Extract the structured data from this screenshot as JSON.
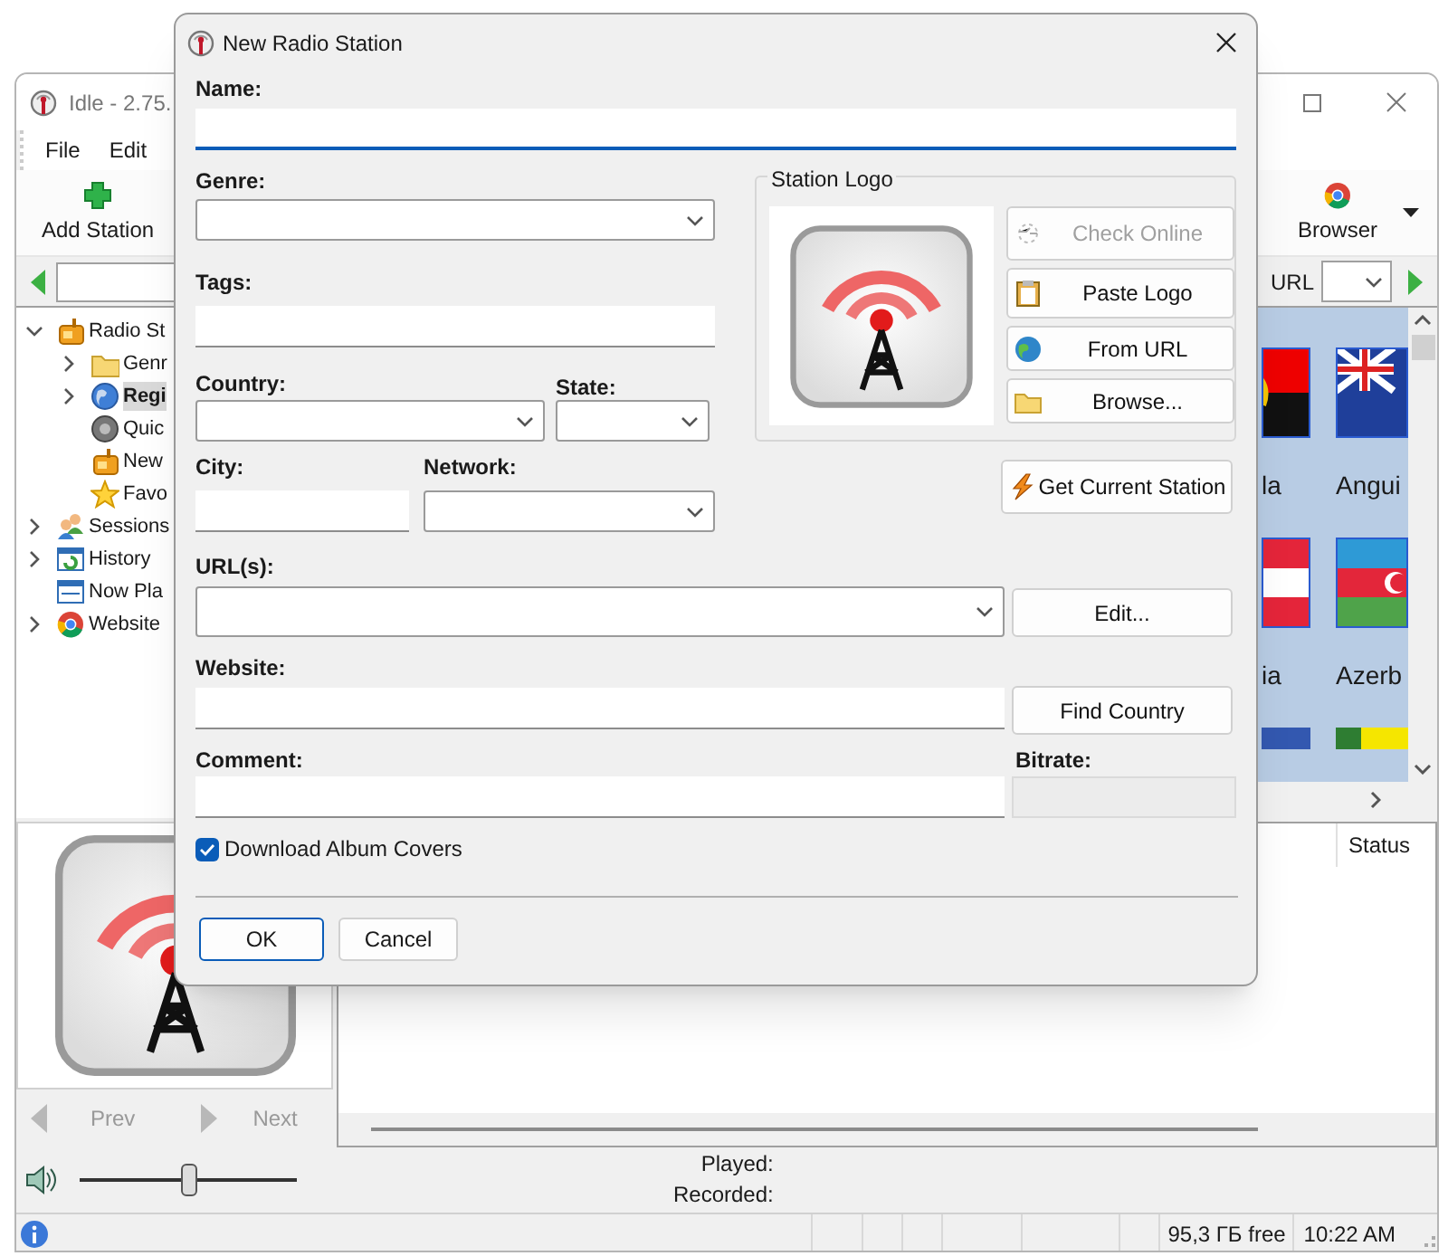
{
  "main_window": {
    "title": "Idle - 2.75.",
    "menu": [
      {
        "label": "File"
      },
      {
        "label": "Edit"
      }
    ],
    "toolbar": [
      {
        "label": "Add Station",
        "kind": "add"
      },
      {
        "label": "Browser",
        "kind": "browser"
      }
    ],
    "address_bar": {
      "url_label": "URL"
    },
    "tree": [
      {
        "label": "Radio St",
        "kind": "radio",
        "expandable": true,
        "expanded": true,
        "selected": false,
        "children": [
          {
            "label": "Genr",
            "kind": "folder",
            "expandable": true,
            "expanded": false,
            "selected": false
          },
          {
            "label": "Regi",
            "kind": "globe",
            "expandable": true,
            "expanded": false,
            "selected": true
          },
          {
            "label": "Quic",
            "kind": "podcast",
            "expandable": false,
            "expanded": false,
            "selected": false
          },
          {
            "label": "New",
            "kind": "radio",
            "expandable": false,
            "expanded": false,
            "selected": false
          },
          {
            "label": "Favo",
            "kind": "star",
            "expandable": false,
            "expanded": false,
            "selected": false
          }
        ]
      },
      {
        "label": "Sessions",
        "kind": "people",
        "expandable": true,
        "expanded": false,
        "selected": false
      },
      {
        "label": "History",
        "kind": "history",
        "expandable": true,
        "expanded": false,
        "selected": false
      },
      {
        "label": "Now Pla",
        "kind": "window",
        "expandable": false,
        "expanded": false,
        "selected": false
      },
      {
        "label": "Website",
        "kind": "chrome",
        "expandable": true,
        "expanded": false,
        "selected": false
      }
    ],
    "flags": [
      {
        "label": "la"
      },
      {
        "label": "Angui"
      },
      {
        "label": "ia"
      },
      {
        "label": "Azerb"
      }
    ],
    "list": {
      "columns": [
        {
          "label": "Status"
        }
      ]
    },
    "player": {
      "prev": {
        "label": "Prev",
        "disabled": true
      },
      "next": {
        "label": "Next",
        "disabled": true
      },
      "volume": {
        "level": 0.5
      },
      "played_label": "Played:",
      "recorded_label": "Recorded:"
    },
    "status_bar": {
      "free_space": "95,3 ГБ free",
      "time": "10:22 AM"
    }
  },
  "dialog": {
    "title": "New Radio Station",
    "fields": {
      "name": {
        "label": "Name:",
        "focused": true
      },
      "genre": {
        "label": "Genre:"
      },
      "tags": {
        "label": "Tags:"
      },
      "country": {
        "label": "Country:"
      },
      "state": {
        "label": "State:"
      },
      "city": {
        "label": "City:"
      },
      "network": {
        "label": "Network:"
      },
      "urls": {
        "label": "URL(s):"
      },
      "website": {
        "label": "Website:"
      },
      "comment": {
        "label": "Comment:"
      },
      "bitrate": {
        "label": "Bitrate:",
        "disabled": true
      }
    },
    "station_logo": {
      "title": "Station Logo",
      "buttons": [
        {
          "label": "Check Online",
          "kind": "check",
          "disabled": true
        },
        {
          "label": "Paste Logo",
          "kind": "paste",
          "disabled": false
        },
        {
          "label": "From URL",
          "kind": "url",
          "disabled": false
        },
        {
          "label": "Browse...",
          "kind": "browse",
          "disabled": false
        }
      ]
    },
    "get_current_station": "Get Current Station",
    "edit_button": "Edit...",
    "find_country_button": "Find Country",
    "download_covers": {
      "label": "Download Album Covers",
      "checked": true
    },
    "buttons": [
      {
        "label": "OK",
        "default": true
      },
      {
        "label": "Cancel",
        "default": false
      }
    ]
  }
}
